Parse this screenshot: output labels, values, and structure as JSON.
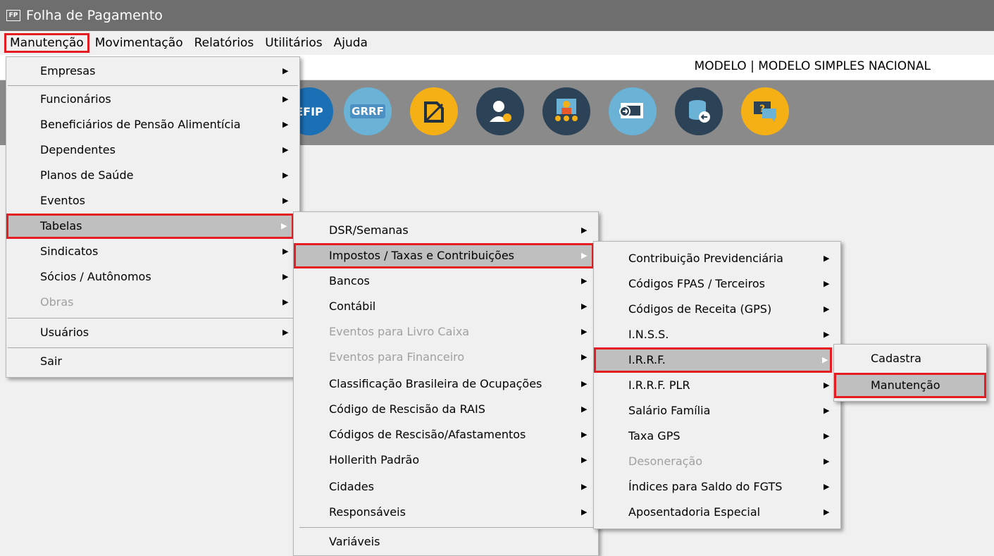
{
  "window": {
    "icon_text": "FP",
    "title": "Folha de Pagamento"
  },
  "menubar": {
    "items": [
      "Manutenção",
      "Movimentação",
      "Relatórios",
      "Utilitários",
      "Ajuda"
    ]
  },
  "infobar": {
    "model": "MODELO | MODELO SIMPLES NACIONAL"
  },
  "toolbar": {
    "icons": [
      {
        "name": "sefip-icon",
        "text": "EFIP",
        "color": "#1b6fb4"
      },
      {
        "name": "grrf-icon",
        "text": "GRRF",
        "color": "#6ab2d6"
      },
      {
        "name": "document-icon",
        "text": "",
        "color": "#f5b015"
      },
      {
        "name": "user-settings-icon",
        "text": "",
        "color": "#2c4256"
      },
      {
        "name": "meeting-icon",
        "text": "",
        "color": "#2c4256"
      },
      {
        "name": "remote-monitor-icon",
        "text": "",
        "color": "#6ab2d6"
      },
      {
        "name": "database-backup-icon",
        "text": "",
        "color": "#2c4256"
      },
      {
        "name": "help-chat-icon",
        "text": "",
        "color": "#f5b015"
      }
    ]
  },
  "menu1": {
    "items": [
      "Empresas",
      "Funcionários",
      "Beneficiários de Pensão Alimentícia",
      "Dependentes",
      "Planos de Saúde",
      "Eventos",
      "Tabelas",
      "Sindicatos",
      "Sócios / Autônomos",
      "Obras",
      "Usuários",
      "Sair"
    ]
  },
  "menu2": {
    "items": [
      "DSR/Semanas",
      "Impostos / Taxas e Contribuições",
      "Bancos",
      "Contábil",
      "Eventos para Livro Caixa",
      "Eventos para Financeiro",
      "Classificação Brasileira de Ocupações",
      "Código de Rescisão da RAIS",
      "Códigos de Rescisão/Afastamentos",
      "Hollerith Padrão",
      "Cidades",
      "Responsáveis",
      "Variáveis"
    ]
  },
  "menu3": {
    "items": [
      "Contribuição Previdenciária",
      "Códigos FPAS / Terceiros",
      "Códigos de Receita (GPS)",
      "I.N.S.S.",
      "I.R.R.F.",
      "I.R.R.F. PLR",
      "Salário Família",
      "Taxa GPS",
      "Desoneração",
      "Índices para Saldo do FGTS",
      "Aposentadoria Especial"
    ]
  },
  "menu4": {
    "items": [
      "Cadastra",
      "Manutenção"
    ]
  },
  "colors": {
    "highlight": "#e41d22",
    "selected": "#bfbfbf",
    "titlebar": "#6e6e6e"
  }
}
